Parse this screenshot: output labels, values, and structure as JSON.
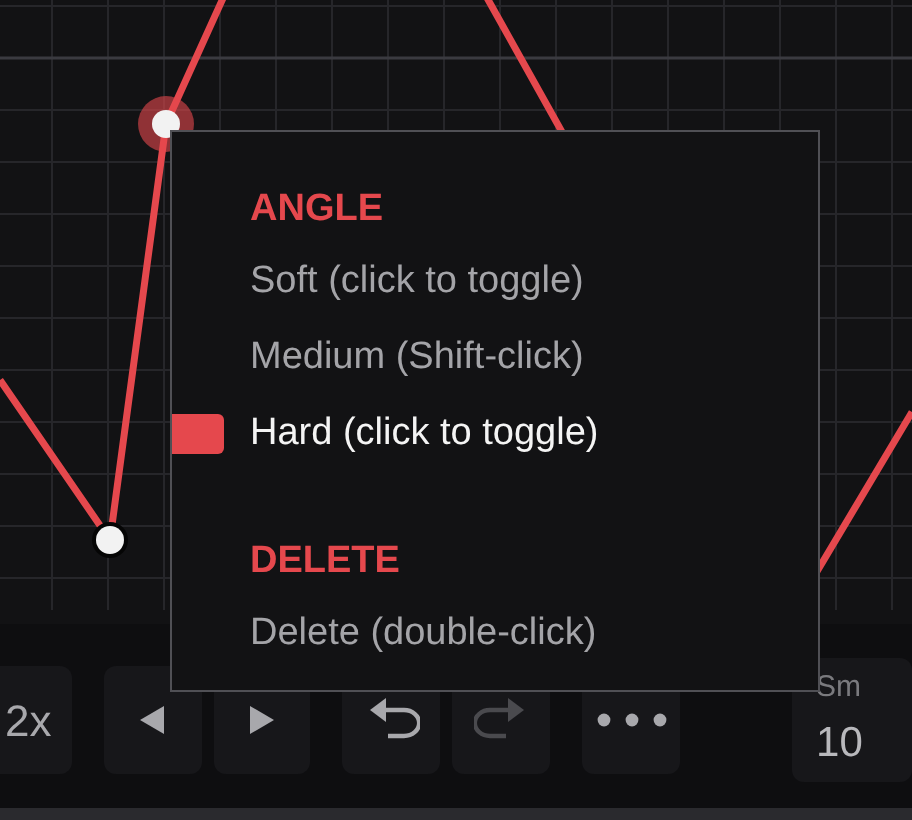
{
  "menu": {
    "sections": [
      {
        "heading": "ANGLE",
        "items": [
          {
            "label": "Soft (click to toggle)",
            "selected": false
          },
          {
            "label": "Medium (Shift-click)",
            "selected": false
          },
          {
            "label": "Hard (click to toggle)",
            "selected": true
          }
        ]
      },
      {
        "heading": "DELETE",
        "items": [
          {
            "label": "Delete (double-click)",
            "selected": false
          }
        ]
      }
    ]
  },
  "toolbar": {
    "buttons": [
      {
        "kind": "text",
        "label": "2x",
        "disabled": false
      },
      {
        "kind": "prev",
        "disabled": false
      },
      {
        "kind": "next",
        "disabled": false
      },
      {
        "kind": "undo",
        "disabled": false
      },
      {
        "kind": "redo",
        "disabled": true
      },
      {
        "kind": "more",
        "disabled": false
      }
    ],
    "field": {
      "label": "Sm",
      "value": "10"
    }
  }
}
